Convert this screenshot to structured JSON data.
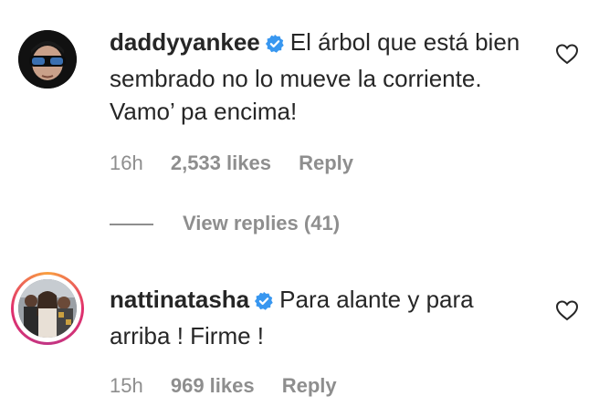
{
  "comments": [
    {
      "username": "daddyyankee",
      "text": "El árbol que está bien sembrado no lo mueve la corriente. Vamo’ pa encima!",
      "time": "16h",
      "likes": "2,533 likes",
      "reply_label": "Reply",
      "avatar_icon": "sunglasses-avatar",
      "heart_icon": "heart-outline-icon"
    },
    {
      "username": "nattinatasha",
      "text": "Para alante y para arriba ! Firme !",
      "time": "15h",
      "likes": "969 likes",
      "reply_label": "Reply",
      "avatar_icon": "group-photo-avatar",
      "heart_icon": "heart-outline-icon",
      "story_ring": true
    }
  ],
  "view_replies_label": "View replies (41)",
  "colors": {
    "text": "#262626",
    "muted": "#8e8e8e",
    "verified": "#3897f0",
    "ring_start": "#f9a03f",
    "ring_end": "#c13584"
  }
}
